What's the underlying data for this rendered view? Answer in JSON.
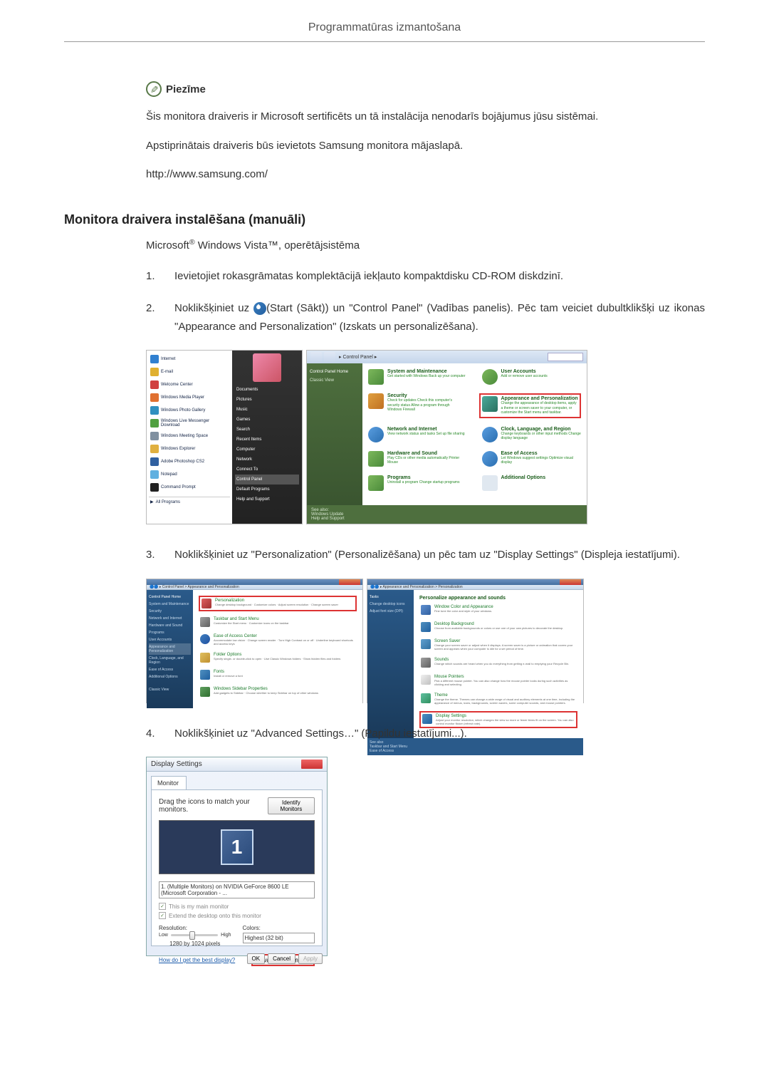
{
  "header": {
    "title": "Programmatūras izmantošana"
  },
  "note": {
    "label": "Piezīme",
    "p1": "Šis monitora draiveris ir Microsoft sertificēts un tā instalācija nenodarīs bojājumus jūsu sistēmai.",
    "p2": "Apstiprinātais draiveris būs ievietots Samsung monitora mājaslapā.",
    "p3": "http://www.samsung.com/"
  },
  "section": {
    "heading": "Monitora draivera instalēšana (manuāli)",
    "subheading_prefix": "Microsoft",
    "subheading_reg": "®",
    "subheading_middle": " Windows Vista™",
    "subheading_suffix": ", operētājsistēma"
  },
  "steps": {
    "s1": {
      "num": "1.",
      "text": "Ievietojiet rokasgrāmatas komplektācijā iekļauto kompaktdisku CD-ROM diskdzinī."
    },
    "s2": {
      "num": "2.",
      "text_a": "Noklikšķiniet uz ",
      "text_b": "(Start (Sākt)) un \"Control Panel\" (Vadības panelis). Pēc tam veiciet dubultklikšķi uz ikonas \"Appearance and Personalization\" (Izskats un personalizēšana)."
    },
    "s3": {
      "num": "3.",
      "text": "Noklikšķiniet uz \"Personalization\" (Personalizēšana) un pēc tam uz \"Display Settings\" (Displeja iestatījumi)."
    },
    "s4": {
      "num": "4.",
      "text": "Noklikšķiniet uz \"Advanced Settings…\" (Papildu iestatījumi...)."
    }
  },
  "startmenu": {
    "items": [
      "Internet",
      "E-mail",
      "Welcome Center",
      "Windows Media Player",
      "Windows Photo Gallery",
      "Windows Live Messenger Download",
      "Windows Meeting Space",
      "Windows Explorer",
      "Adobe Photoshop CS2",
      "Notepad",
      "Command Prompt"
    ],
    "all_programs": "All Programs",
    "right_items": [
      "Documents",
      "Pictures",
      "Music",
      "Games",
      "Search",
      "Recent Items",
      "Computer",
      "Network",
      "Connect To",
      "Control Panel",
      "Default Programs",
      "Help and Support"
    ]
  },
  "controlpanel": {
    "addressbar": "Control Panel",
    "sidebar_title": "Control Panel Home",
    "sidebar_item": "Classic View",
    "categories": {
      "c1": {
        "title": "System and Maintenance",
        "sub": "Get started with Windows\nBack up your computer"
      },
      "c2": {
        "title": "User Accounts",
        "sub": "Add or remove user accounts"
      },
      "c3": {
        "title": "Security",
        "sub": "Check for updates\nCheck this computer's security status\nAllow a program through Windows Firewall"
      },
      "c4": {
        "title": "Appearance and Personalization",
        "sub": "Change the appearance of desktop items, apply a theme or screen saver to your computer, or customize the Start menu and taskbar."
      },
      "c5": {
        "title": "Network and Internet",
        "sub": "View network status and tasks\nSet up file sharing"
      },
      "c6": {
        "title": "Clock, Language, and Region",
        "sub": "Change keyboards or other input methods\nChange display language"
      },
      "c7": {
        "title": "Hardware and Sound",
        "sub": "Play CDs or other media automatically\nPrinter\nMouse"
      },
      "c8": {
        "title": "Ease of Access",
        "sub": "Let Windows suggest settings\nOptimize visual display"
      },
      "c9": {
        "title": "Programs",
        "sub": "Uninstall a program\nChange startup programs"
      },
      "c10": {
        "title": "Additional Options",
        "sub": ""
      }
    },
    "footer_title": "See also:",
    "footer_items": [
      "Windows Update",
      "Help and Support"
    ]
  },
  "personalization_left": {
    "addressbar": "Control Panel > Appearance and Personalization",
    "sidebar_title": "Control Panel Home",
    "sidebar_items": [
      "System and Maintenance",
      "Security",
      "Network and Internet",
      "Hardware and Sound",
      "Programs",
      "User Accounts",
      "Appearance and Personalization",
      "Clock, Language, and Region",
      "Ease of Access",
      "Additional Options",
      "Classic View"
    ],
    "items": {
      "i1": {
        "title": "Personalization",
        "sub": "Change desktop background · Customize colors · Adjust screen resolution · Change screen saver"
      },
      "i2": {
        "title": "Taskbar and Start Menu",
        "sub": "Customize the Start menu · Customize icons on the taskbar"
      },
      "i3": {
        "title": "Ease of Access Center",
        "sub": "Accommodate low vision · Change screen reader · Turn High Contrast on or off · Underline keyboard shortcuts and access keys"
      },
      "i4": {
        "title": "Folder Options",
        "sub": "Specify single- or double-click to open · Use Classic Windows folders · Show hidden files and folders"
      },
      "i5": {
        "title": "Fonts",
        "sub": "Install or remove a font"
      },
      "i6": {
        "title": "Windows Sidebar Properties",
        "sub": "Add gadgets to Sidebar · Choose whether to keep Sidebar on top of other windows"
      }
    }
  },
  "personalization_right": {
    "addressbar": "Appearance and Personalization > Personalization",
    "heading": "Personalize appearance and sounds",
    "sidebar_items": [
      "Tasks",
      "Change desktop icons",
      "Adjust font size (DPI)"
    ],
    "items": {
      "i1": {
        "title": "Window Color and Appearance",
        "sub": "Fine tune the color and style of your windows."
      },
      "i2": {
        "title": "Desktop Background",
        "sub": "Choose from available backgrounds or colors or use one of your own pictures to decorate the desktop."
      },
      "i3": {
        "title": "Screen Saver",
        "sub": "Change your screen saver or adjust when it displays. A screen saver is a picture or animation that covers your screen and appears when your computer is idle for a set period of time."
      },
      "i4": {
        "title": "Sounds",
        "sub": "Change which sounds are heard when you do everything from getting e-mail to emptying your Recycle Bin."
      },
      "i5": {
        "title": "Mouse Pointers",
        "sub": "Pick a different mouse pointer. You can also change how the mouse pointer looks during such activities as clicking and selecting."
      },
      "i6": {
        "title": "Theme",
        "sub": "Change the theme. Themes can change a wide range of visual and auditory elements at one time, including the appearance of menus, icons, backgrounds, screen savers, some computer sounds, and mouse pointers."
      },
      "i7": {
        "title": "Display Settings",
        "sub": "Adjust your monitor resolution, which changes the view so more or fewer items fit on the screen. You can also control monitor flicker (refresh rate)."
      }
    },
    "footer_title": "See also",
    "footer_items": [
      "Taskbar and Start Menu",
      "Ease of Access"
    ]
  },
  "display_settings": {
    "title": "Display Settings",
    "tab": "Monitor",
    "drag_text": "Drag the icons to match your monitors.",
    "identify_btn": "Identify Monitors",
    "monitor_num": "1",
    "dropdown": "1. (Multiple Monitors) on NVIDIA GeForce 8600 LE (Microsoft Corporation - ...",
    "cb1": "This is my main monitor",
    "cb2": "Extend the desktop onto this monitor",
    "resolution_label": "Resolution:",
    "res_low": "Low",
    "res_high": "High",
    "res_value": "1280 by 1024 pixels",
    "colors_label": "Colors:",
    "colors_value": "Highest (32 bit)",
    "link": "How do I get the best display?",
    "adv_btn": "Advanced Settings...",
    "ok": "OK",
    "cancel": "Cancel",
    "apply": "Apply"
  }
}
